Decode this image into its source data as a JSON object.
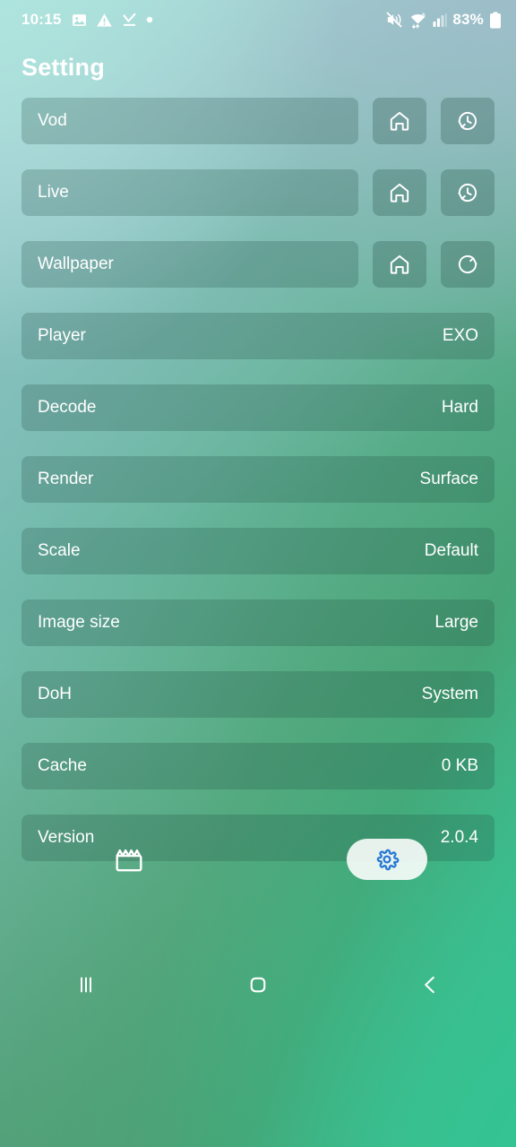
{
  "status_bar": {
    "time": "10:15",
    "left_icons": [
      "image-icon",
      "warning-triangle-icon",
      "download-complete-icon",
      "dot-icon"
    ],
    "right_icons": [
      "mute-icon",
      "wifi-6-data-icon",
      "cellular-signal-icon",
      "battery-icon"
    ],
    "battery_percent": "83%"
  },
  "header": {
    "title": "Setting"
  },
  "source_rows": [
    {
      "label": "Vod",
      "home_icon": "home-icon",
      "action_icon": "history-icon"
    },
    {
      "label": "Live",
      "home_icon": "home-icon",
      "action_icon": "history-icon"
    },
    {
      "label": "Wallpaper",
      "home_icon": "home-icon",
      "action_icon": "refresh-icon"
    }
  ],
  "setting_rows": [
    {
      "label": "Player",
      "value": "EXO"
    },
    {
      "label": "Decode",
      "value": "Hard"
    },
    {
      "label": "Render",
      "value": "Surface"
    },
    {
      "label": "Scale",
      "value": "Default"
    },
    {
      "label": "Image size",
      "value": "Large"
    },
    {
      "label": "DoH",
      "value": "System"
    },
    {
      "label": "Cache",
      "value": "0 KB"
    },
    {
      "label": "Version",
      "value": "2.0.4"
    }
  ],
  "bottom_tabs": [
    {
      "name": "vod",
      "icon": "clapperboard-icon",
      "selected": false
    },
    {
      "name": "setting",
      "icon": "gear-icon",
      "selected": true
    }
  ],
  "nav_bar": {
    "recents": "recents-icon",
    "home": "home-square-icon",
    "back": "back-chevron-icon"
  },
  "colors": {
    "accent_blue": "#2979d6",
    "text_white": "#ffffff",
    "pill_overlay": "rgba(28,70,58,0.22)",
    "bg_top_left": "#a8ded8",
    "bg_top_right": "#9ebdca",
    "bg_bottom_left": "#4d9a70",
    "bg_bottom_right": "#35c193"
  }
}
